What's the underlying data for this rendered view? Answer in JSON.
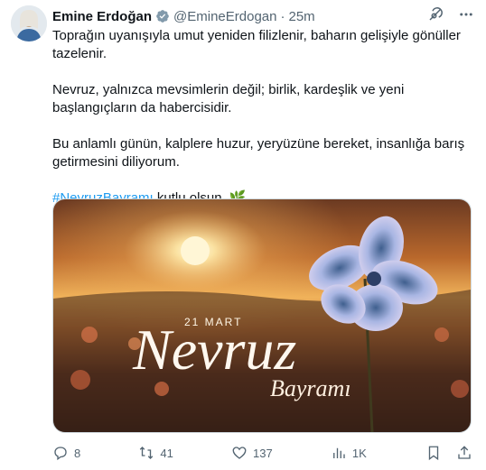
{
  "author": {
    "name": "Emine Erdoğan",
    "handle": "@EmineErdogan",
    "separator": "·",
    "time": "25m"
  },
  "tweet": {
    "paragraphs": [
      "Toprağın uyanışıyla umut yeniden filizlenir, baharın gelişiyle gönüller tazelenir.",
      "Nevruz, yalnızca mevsimlerin değil; birlik, kardeşlik ve yeni başlangıçların da habercisidir.",
      "Bu anlamlı günün, kalplere huzur, yeryüzüne bereket, insanlığa barış getirmesini diliyorum."
    ],
    "hashtag": "#NevruzBayramı",
    "closing": " kutlu olsun. 🌿"
  },
  "media": {
    "date_text": "21 MART",
    "title_text": "Nevruz",
    "subtitle_text": "Bayramı"
  },
  "actions": {
    "replies": "8",
    "reposts": "41",
    "likes": "137",
    "views": "1K"
  },
  "icons": {
    "verified": "verified-badge-icon",
    "grok": "grok-icon",
    "more": "more-icon",
    "reply": "reply-icon",
    "repost": "repost-icon",
    "like": "like-icon",
    "views": "views-icon",
    "bookmark": "bookmark-icon",
    "share": "share-icon"
  },
  "colors": {
    "text": "#0f1419",
    "secondary": "#536471",
    "link": "#1d9bf0",
    "verified": "#829aab"
  }
}
